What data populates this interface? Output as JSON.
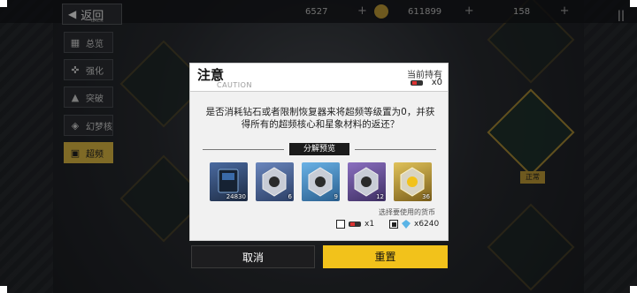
{
  "topbar": {
    "back_label": "返回",
    "back_sub": "BACK",
    "resource1": "6527",
    "resource2": "611899",
    "resource3": "158",
    "pause_glyph": "||"
  },
  "menu": [
    {
      "label": "总览",
      "icon": "overview-icon",
      "glyph": "▦"
    },
    {
      "label": "强化",
      "icon": "enhance-icon",
      "glyph": "✜"
    },
    {
      "label": "突破",
      "icon": "breakthrough-icon",
      "glyph": "▲"
    },
    {
      "label": "幻梦核",
      "icon": "dream-core-icon",
      "glyph": "◈"
    },
    {
      "label": "超频",
      "icon": "overclock-icon",
      "glyph": "▣"
    }
  ],
  "background": {
    "node_label": "正常"
  },
  "dialog": {
    "title": "注意",
    "subtitle": "CAUTION",
    "hold_label": "当前持有",
    "hold_count": "x0",
    "message": "是否消耗钻石或者限制恢复器来将超频等级置为0，并获得所有的超频核心和星象材料的返还？",
    "section_title": "分解预览",
    "items": [
      {
        "name": "book",
        "count": "24830",
        "color": "#2a3d5a"
      },
      {
        "name": "core-blue-1",
        "count": "6",
        "color": "#3f5a8a"
      },
      {
        "name": "core-cyan",
        "count": "9",
        "color": "#3a7fb5"
      },
      {
        "name": "core-purple",
        "count": "12",
        "color": "#5e4a86"
      },
      {
        "name": "core-gold",
        "count": "36",
        "color": "#a88a2c"
      }
    ],
    "choose_label": "选择要使用的货币",
    "option_restorer": "x1",
    "option_diamond": "x6240"
  },
  "buttons": {
    "cancel": "取消",
    "confirm": "重置"
  },
  "colors": {
    "accent": "#f2c21b",
    "dark": "#1d1d1f"
  }
}
